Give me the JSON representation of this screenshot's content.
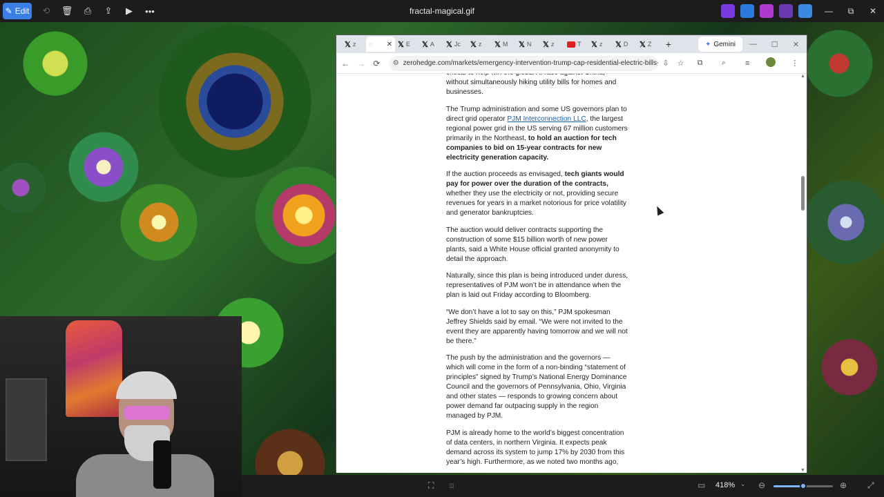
{
  "viewer": {
    "edit_label": "Edit",
    "file_name": "fractal-magical.gif",
    "zoom": "418%",
    "zoom_fraction": 0.5
  },
  "browser": {
    "tabs": [
      {
        "icon": "x",
        "label": "z"
      },
      {
        "icon": "loading",
        "label": "",
        "active": true
      },
      {
        "icon": "x",
        "label": "E"
      },
      {
        "icon": "x",
        "label": "A"
      },
      {
        "icon": "x",
        "label": "Jc"
      },
      {
        "icon": "x",
        "label": "z"
      },
      {
        "icon": "x",
        "label": "M"
      },
      {
        "icon": "x",
        "label": "N"
      },
      {
        "icon": "x",
        "label": "z"
      },
      {
        "icon": "youtube",
        "label": "T"
      },
      {
        "icon": "x",
        "label": "z"
      },
      {
        "icon": "x",
        "label": "D"
      },
      {
        "icon": "x",
        "label": "Z"
      }
    ],
    "gemini_label": "Gemini",
    "url": "zerohedge.com/markets/emergency-intervention-trump-cap-residential-electric-bills-for..."
  },
  "article": {
    "p0": "critical to help win the global AI race against China, without simultaneously hiking utility bills for homes and businesses.",
    "p1_a": "The Trump administration and some US governors plan to direct grid operator ",
    "p1_link": "PJM Interconnection LLC",
    "p1_b": ", the largest regional power grid in the US serving 67 million customers primarily in the Northeast, ",
    "p1_bold": "to hold an auction for tech companies to bid on 15-year contracts for new electricity generation capacity.",
    "p2_a": "If the auction proceeds as envisaged, ",
    "p2_bold": "tech giants would pay for power over the duration of the contracts,",
    "p2_b": " whether they use the electricity or not, providing secure revenues for years in a market notorious for price volatility and generator bankruptcies.",
    "p3": "The auction would deliver contracts supporting the construction of some $15 billion worth of new power plants, said a White House official granted anonymity to detail the approach.",
    "p4": "Naturally, since this plan is being introduced under duress, representatives of PJM won’t be in attendance when the plan is laid out Friday according to Bloomberg.",
    "p5": "“We don’t have a lot to say on this,” PJM spokesman Jeffrey Shields said by email. “We were not invited to the event they are apparently having tomorrow and we will not be there.”",
    "p6": "The push by the administration and the governors — which will come in the form of a non-binding “statement of principles” signed by Trump’s National Energy Dominance Council and the governors of Pennsylvania, Ohio, Virginia and other states — responds to growing concern about power demand far outpacing supply in the region managed by PJM.",
    "p7": "PJM is already home to the world’s biggest concentration of data centers, in northern Virginia. It expects peak demand across its system to jump 17% by 2030 from this year’s high. Furthermore, as we noted two months ago,"
  }
}
